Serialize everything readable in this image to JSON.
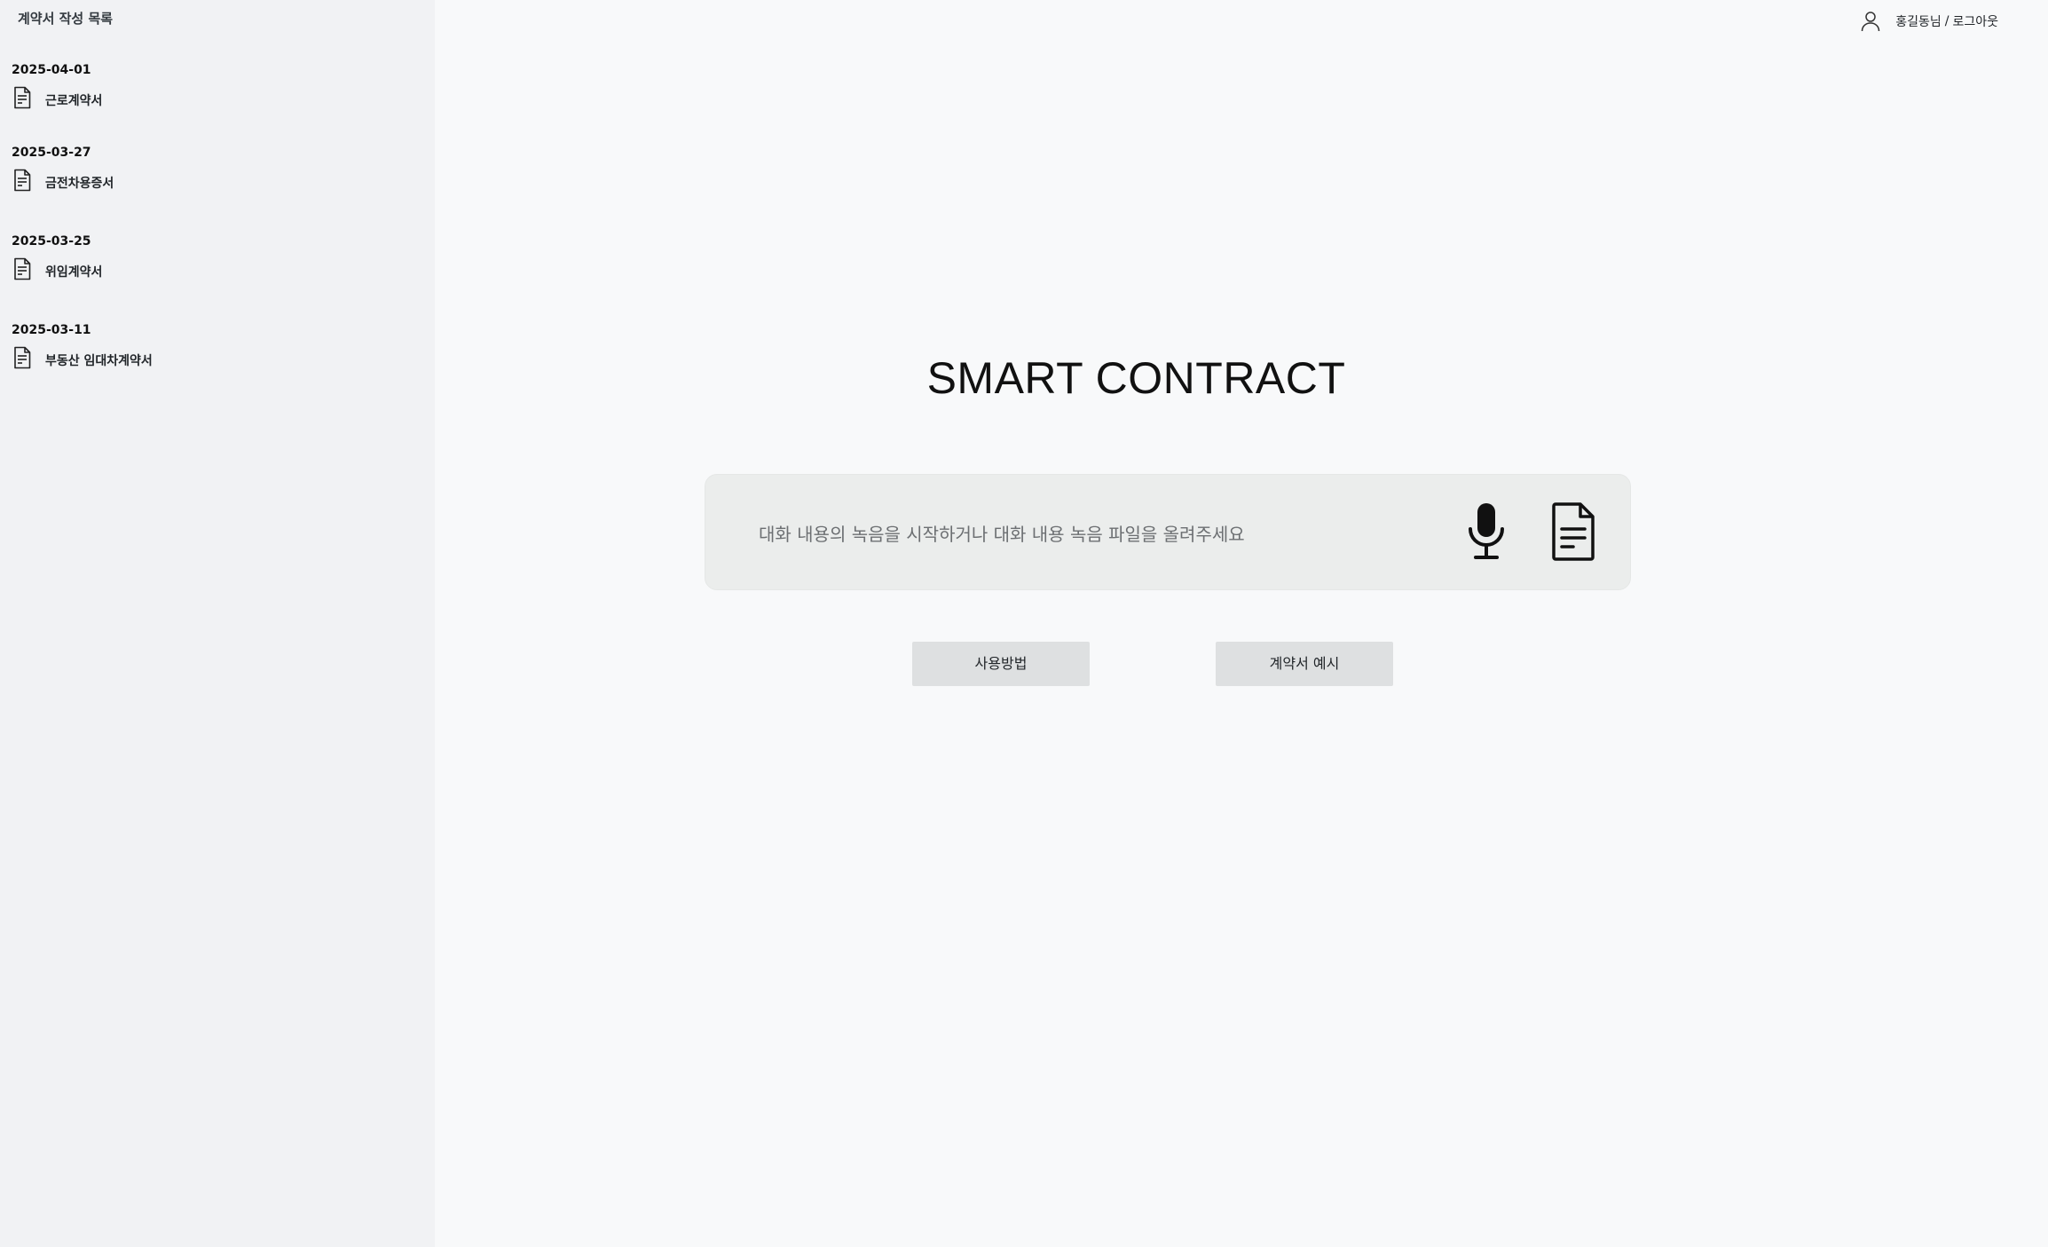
{
  "sidebar": {
    "title": "계약서 작성 목록",
    "groups": [
      {
        "date": "2025-04-01",
        "items": [
          {
            "label": "근로계약서",
            "icon": "document-icon"
          }
        ]
      },
      {
        "date": "2025-03-27",
        "items": [
          {
            "label": "금전차용증서",
            "icon": "document-icon"
          }
        ]
      },
      {
        "date": "2025-03-25",
        "items": [
          {
            "label": "위임계약서",
            "icon": "document-icon"
          }
        ]
      },
      {
        "date": "2025-03-11",
        "items": [
          {
            "label": "부동산 임대차계약서",
            "icon": "document-icon"
          }
        ]
      }
    ]
  },
  "header": {
    "user_icon": "user-icon",
    "user_name": "홍길동님",
    "separator": "/",
    "logout_label": "로그아웃"
  },
  "main": {
    "title": "SMART CONTRACT",
    "input": {
      "placeholder": "대화 내용의 녹음을 시작하거나 대화 내용 녹음 파일을 올려주세요",
      "mic_icon": "microphone-icon",
      "upload_icon": "file-upload-icon"
    },
    "buttons": {
      "howto_label": "사용방법",
      "example_label": "계약서 예시"
    }
  },
  "colors": {
    "page_bg": "#f8f9fa",
    "sidebar_bg": "#f1f2f4",
    "input_bg": "#ebedec",
    "button_bg": "#dee0e1",
    "text": "#212529"
  }
}
